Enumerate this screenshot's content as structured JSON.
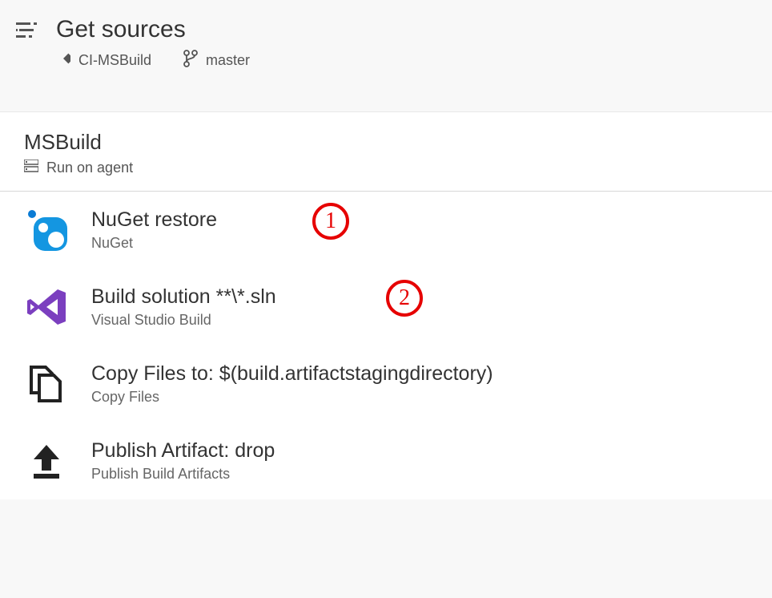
{
  "header": {
    "title": "Get sources",
    "repo": "CI-MSBuild",
    "branch": "master"
  },
  "section": {
    "title": "MSBuild",
    "subtitle": "Run on agent"
  },
  "tasks": [
    {
      "title": "NuGet restore",
      "subtitle": "NuGet"
    },
    {
      "title": "Build solution **\\*.sln",
      "subtitle": "Visual Studio Build"
    },
    {
      "title": "Copy Files to: $(build.artifactstagingdirectory)",
      "subtitle": "Copy Files"
    },
    {
      "title": "Publish Artifact: drop",
      "subtitle": "Publish Build Artifacts"
    }
  ],
  "callouts": {
    "one": "1",
    "two": "2"
  }
}
